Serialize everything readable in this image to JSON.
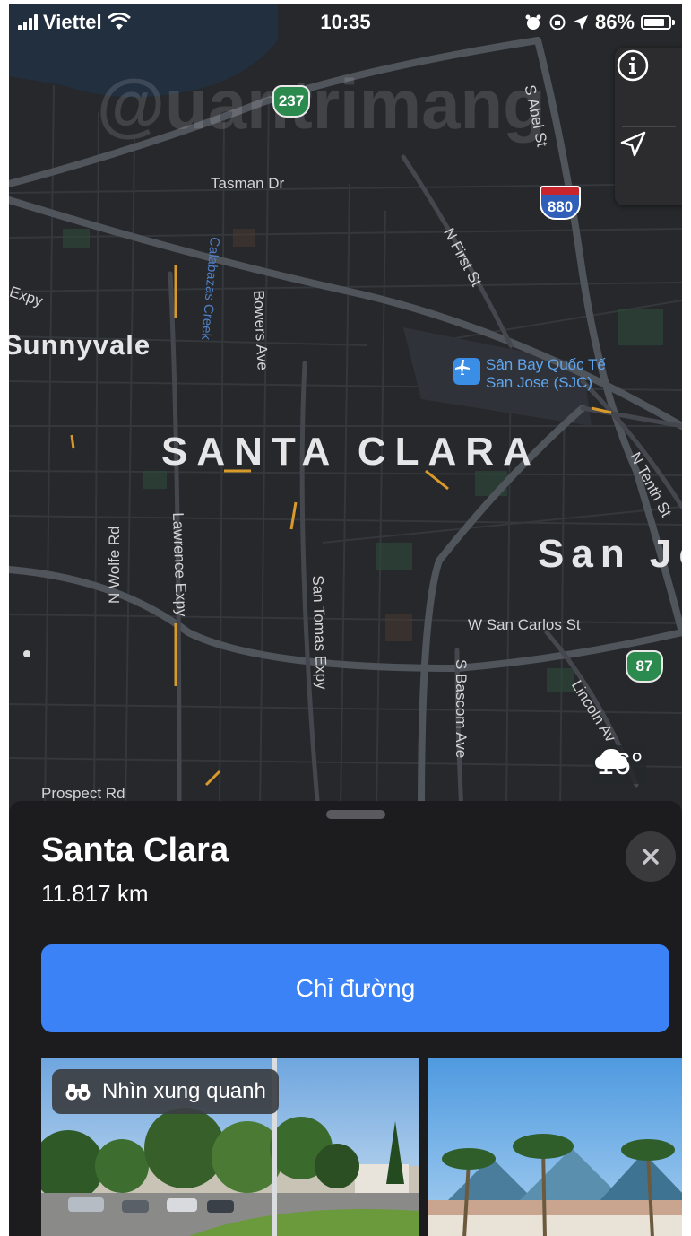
{
  "status_bar": {
    "carrier": "Viettel",
    "time": "10:35",
    "battery": "86%",
    "battery_level": 0.86
  },
  "map": {
    "watermark": "@uantrimang",
    "labels": {
      "tasman": "Tasman Dr",
      "abel": "S Abel St",
      "first": "N First St",
      "calabazas": "Calabazas Creek",
      "bowers": "Bowers Ave",
      "expy": "l Expy",
      "lawrence": "Lawrence Expy",
      "wolfe": "N Wolfe Rd",
      "san_tomas": "San Tomas Expy",
      "w_san_carlos": "W San Carlos St",
      "bascom": "S Bascom Ave",
      "lincoln": "Lincoln Av",
      "tenth": "N Tenth St",
      "prospect": "Prospect Rd",
      "airport_line1": "Sân Bay Quốc Tế",
      "airport_line2": "San Jose (SJC)"
    },
    "cities": {
      "sunnyvale": "Sunnyvale",
      "santa_clara": "SANTA CLARA",
      "san_jose": "San Jo"
    },
    "shields": {
      "hw237": "237",
      "i880": "880",
      "hw87": "87"
    },
    "weather": {
      "temp": "16°",
      "icon": "cloud-icon"
    }
  },
  "place": {
    "title": "Santa Clara",
    "distance": "11.817 km",
    "directions_label": "Chỉ đường",
    "look_around_label": "Nhìn xung quanh"
  },
  "colors": {
    "accent_blue": "#3a82f6",
    "map_bg": "#26282b",
    "sheet_bg": "#1c1c1e"
  }
}
